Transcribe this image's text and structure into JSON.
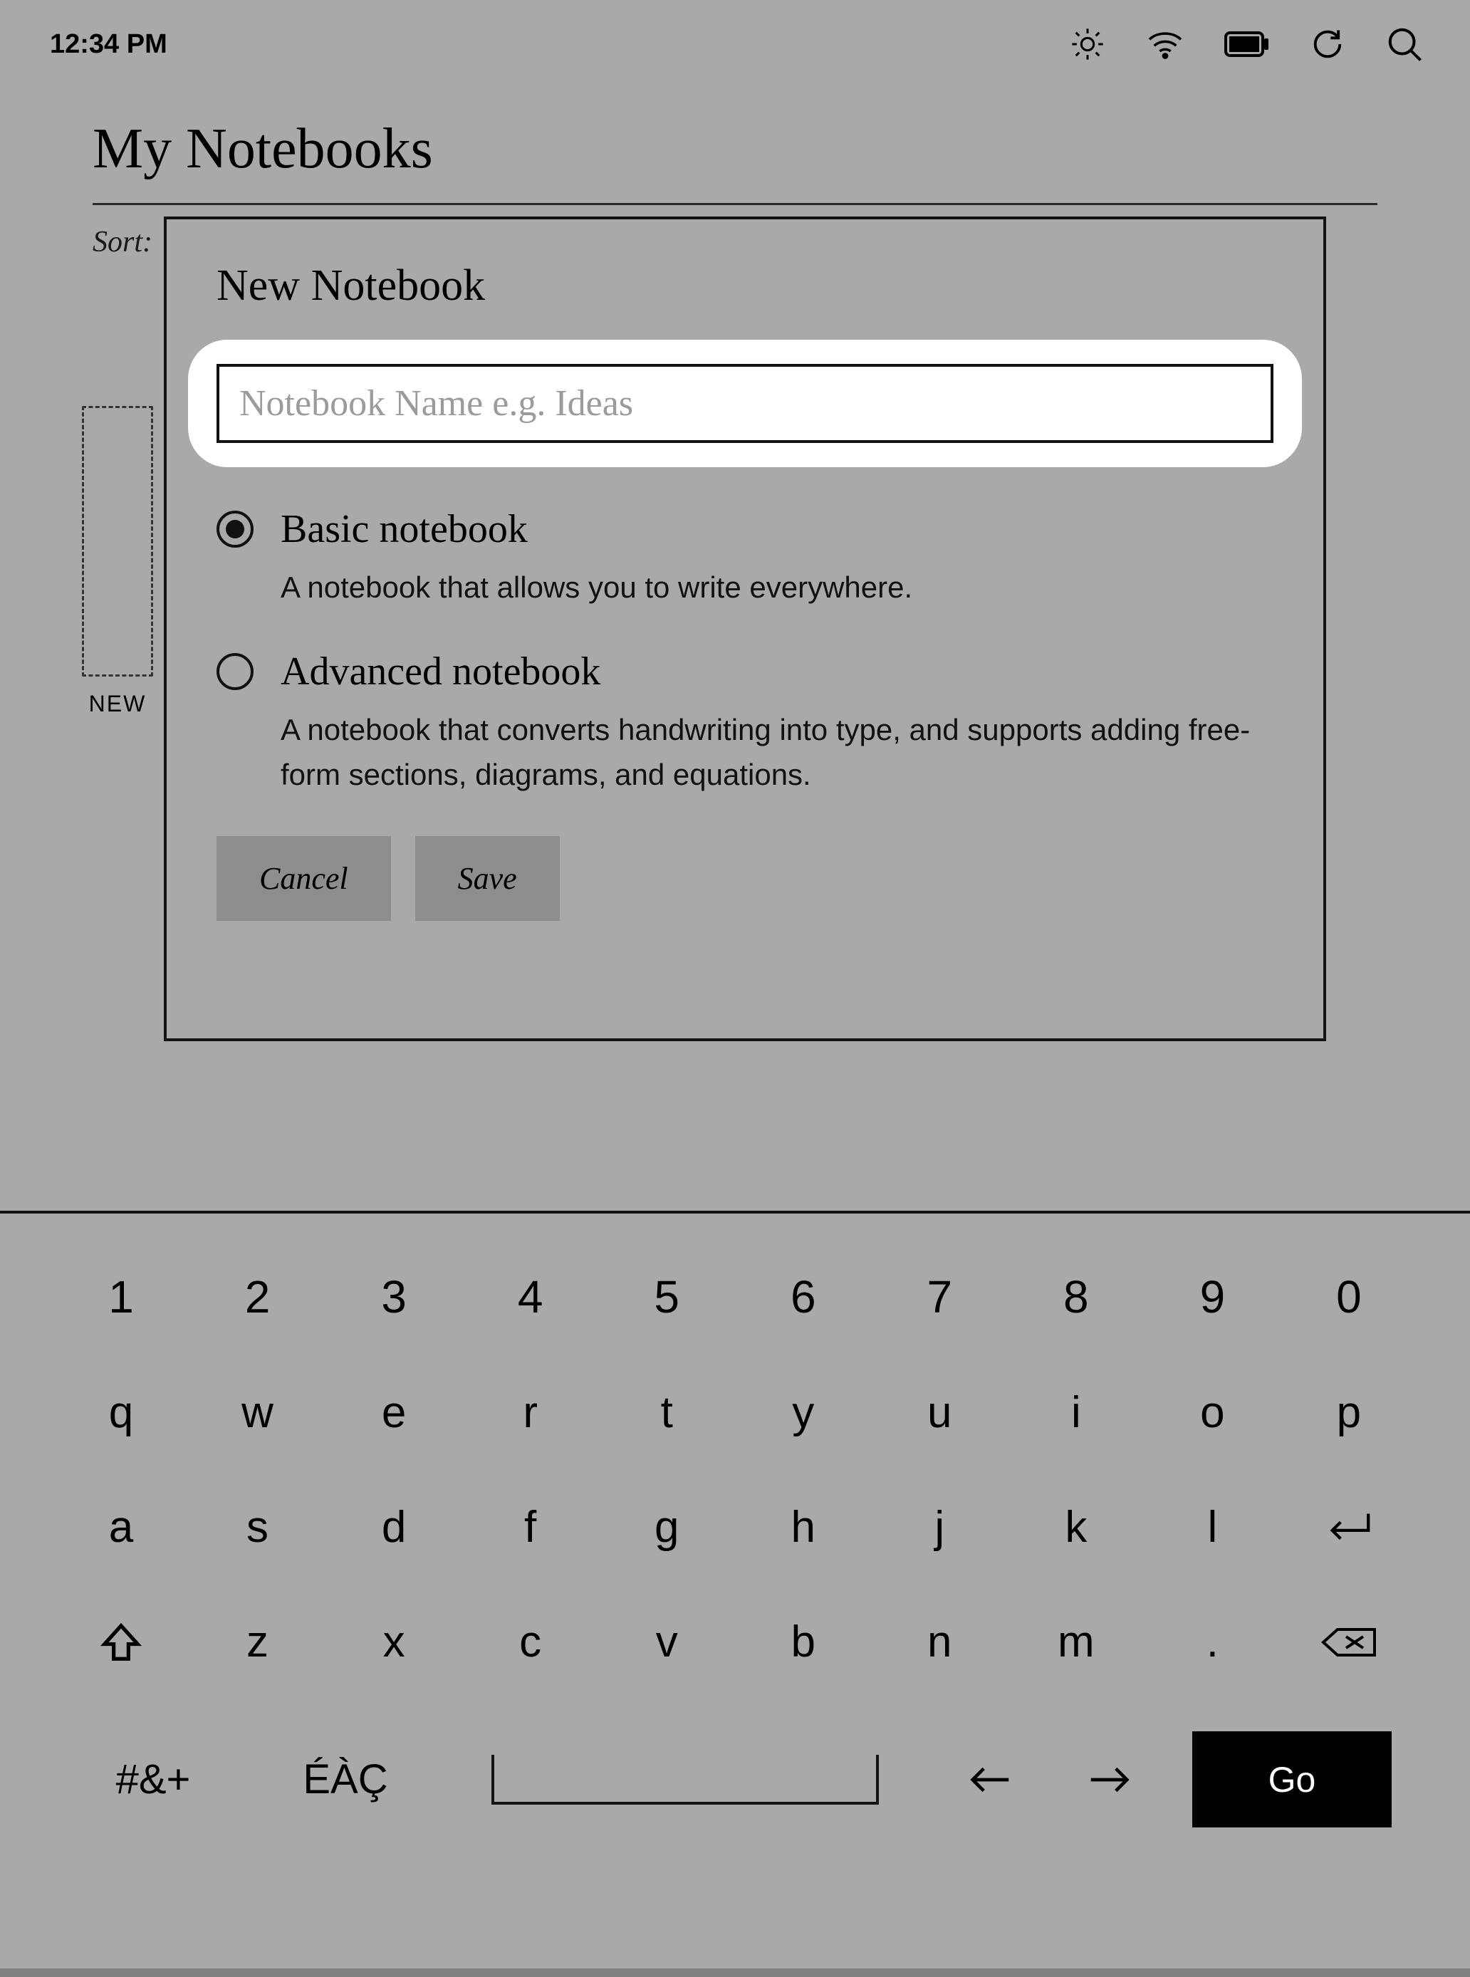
{
  "status": {
    "time": "12:34 PM"
  },
  "page": {
    "title": "My Notebooks",
    "sort_label": "Sort:",
    "new_label": "NEW"
  },
  "dialog": {
    "title": "New Notebook",
    "name_placeholder": "Notebook Name e.g. Ideas",
    "name_value": "",
    "options": [
      {
        "title": "Basic notebook",
        "desc": "A notebook that allows you to write everywhere.",
        "selected": true
      },
      {
        "title": "Advanced notebook",
        "desc": "A notebook that converts handwriting into type, and supports adding free-form sections, diagrams, and equations.",
        "selected": false
      }
    ],
    "cancel_label": "Cancel",
    "save_label": "Save"
  },
  "keyboard": {
    "row_num": [
      "1",
      "2",
      "3",
      "4",
      "5",
      "6",
      "7",
      "8",
      "9",
      "0"
    ],
    "row_q": [
      "q",
      "w",
      "e",
      "r",
      "t",
      "y",
      "u",
      "i",
      "o",
      "p"
    ],
    "row_a": [
      "a",
      "s",
      "d",
      "f",
      "g",
      "h",
      "j",
      "k",
      "l"
    ],
    "row_z": [
      "z",
      "x",
      "c",
      "v",
      "b",
      "n",
      "m",
      "."
    ],
    "sym_label": "#&+",
    "accent_label": "ÉÀÇ",
    "go_label": "Go"
  }
}
